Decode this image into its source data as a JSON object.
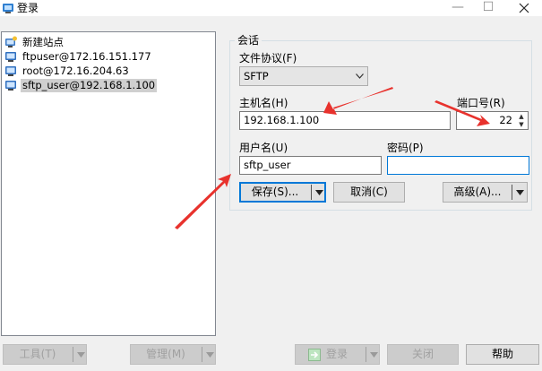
{
  "window": {
    "title": "登录",
    "minimize_glyph": "—",
    "maximize_glyph": "☐"
  },
  "sites": [
    {
      "label": "新建站点",
      "icon": "new-site-icon"
    },
    {
      "label": "ftpuser@172.16.151.177",
      "icon": "monitor-icon"
    },
    {
      "label": "root@172.16.204.63",
      "icon": "monitor-icon"
    },
    {
      "label": "sftp_user@192.168.1.100",
      "icon": "monitor-icon",
      "selected": true
    }
  ],
  "session": {
    "group_label": "会话",
    "protocol_label": "文件协议(F)",
    "protocol_value": "SFTP",
    "host_label": "主机名(H)",
    "host_value": "192.168.1.100",
    "port_label": "端口号(R)",
    "port_value": "22",
    "user_label": "用户名(U)",
    "user_value": "sftp_user",
    "password_label": "密码(P)",
    "password_value": "",
    "save_button": "保存(S)...",
    "cancel_button": "取消(C)",
    "advanced_button": "高级(A)..."
  },
  "bottom_bar": {
    "tools_button": "工具(T)",
    "manage_button": "管理(M)",
    "login_button": "登录",
    "close_button": "关闭",
    "help_button": "帮助"
  },
  "colors": {
    "annotation_arrow": "#e8322d",
    "focus_border": "#0078d7"
  }
}
